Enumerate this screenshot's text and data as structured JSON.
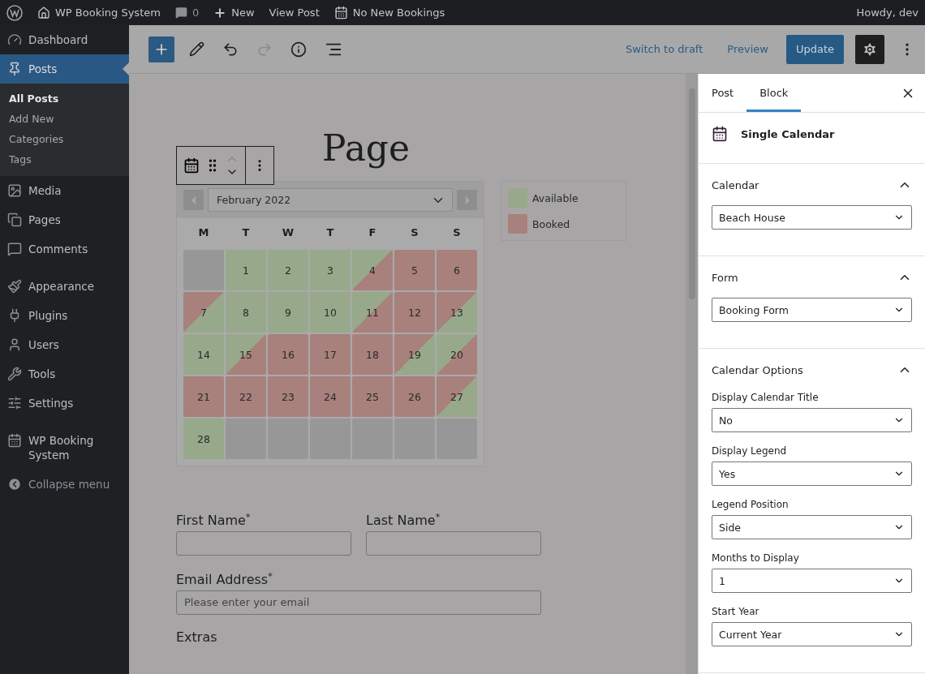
{
  "admin_bar": {
    "site": "WP Booking System",
    "comments": "0",
    "new": "New",
    "view": "View Post",
    "bookings": "No New Bookings",
    "greeting": "Howdy, dev"
  },
  "sidebar": {
    "items": [
      {
        "label": "Dashboard",
        "selected": false
      },
      {
        "label": "Posts",
        "selected": true,
        "children": [
          {
            "label": "All Posts",
            "selected": true
          },
          {
            "label": "Add New",
            "selected": false
          },
          {
            "label": "Categories",
            "selected": false
          },
          {
            "label": "Tags",
            "selected": false
          }
        ]
      },
      {
        "label": "Media",
        "selected": false
      },
      {
        "label": "Pages",
        "selected": false
      },
      {
        "label": "Comments",
        "selected": false
      },
      {
        "label": "Appearance",
        "selected": false
      },
      {
        "label": "Plugins",
        "selected": false
      },
      {
        "label": "Users",
        "selected": false
      },
      {
        "label": "Tools",
        "selected": false
      },
      {
        "label": "Settings",
        "selected": false
      },
      {
        "label": "WP Booking System",
        "selected": false
      }
    ],
    "collapse": "Collapse menu"
  },
  "editor_header": {
    "switch_draft": "Switch to draft",
    "preview": "Preview",
    "update": "Update"
  },
  "post": {
    "title": "Page",
    "calendar": {
      "month": "February 2022",
      "weekdays": [
        "M",
        "T",
        "W",
        "T",
        "F",
        "S",
        "S"
      ],
      "days": [
        {
          "kind": "empty"
        },
        {
          "label": "1",
          "kind": "available"
        },
        {
          "label": "2",
          "kind": "available"
        },
        {
          "label": "3",
          "kind": "available"
        },
        {
          "label": "4",
          "kind": "available-booked"
        },
        {
          "label": "5",
          "kind": "booked"
        },
        {
          "label": "6",
          "kind": "booked"
        },
        {
          "label": "7",
          "kind": "booked-available"
        },
        {
          "label": "8",
          "kind": "available"
        },
        {
          "label": "9",
          "kind": "available"
        },
        {
          "label": "10",
          "kind": "available"
        },
        {
          "label": "11",
          "kind": "available-booked"
        },
        {
          "label": "12",
          "kind": "booked"
        },
        {
          "label": "13",
          "kind": "booked-available"
        },
        {
          "label": "14",
          "kind": "available"
        },
        {
          "label": "15",
          "kind": "available-booked"
        },
        {
          "label": "16",
          "kind": "booked"
        },
        {
          "label": "17",
          "kind": "booked"
        },
        {
          "label": "18",
          "kind": "booked"
        },
        {
          "label": "19",
          "kind": "booked-available"
        },
        {
          "label": "20",
          "kind": "available-booked"
        },
        {
          "label": "21",
          "kind": "booked"
        },
        {
          "label": "22",
          "kind": "booked"
        },
        {
          "label": "23",
          "kind": "booked"
        },
        {
          "label": "24",
          "kind": "booked"
        },
        {
          "label": "25",
          "kind": "booked"
        },
        {
          "label": "26",
          "kind": "booked"
        },
        {
          "label": "27",
          "kind": "booked-available"
        },
        {
          "label": "28",
          "kind": "available"
        },
        {
          "kind": "empty"
        },
        {
          "kind": "empty"
        },
        {
          "kind": "empty"
        },
        {
          "kind": "empty"
        },
        {
          "kind": "empty"
        },
        {
          "kind": "empty"
        }
      ]
    },
    "legend": [
      {
        "label": "Available",
        "color": "#97a98a"
      },
      {
        "label": "Booked",
        "color": "#a8807c"
      }
    ],
    "form": {
      "first_name": "First Name$^{*}$",
      "last_name": "Last Name$^{*}$",
      "email": "Email Address$^{*}$",
      "email_placeholder": "Please enter your email",
      "extras": "Extras"
    }
  },
  "inspector": {
    "tabs": [
      {
        "label": "Post",
        "selected": false
      },
      {
        "label": "Block",
        "selected": true
      }
    ],
    "block_name": "Single Calendar",
    "sections": [
      {
        "title": "Calendar",
        "expanded": true,
        "fields": [
          {
            "value": "Beach House"
          }
        ]
      },
      {
        "title": "Form",
        "expanded": true,
        "fields": [
          {
            "value": "Booking Form"
          }
        ]
      },
      {
        "title": "Calendar Options",
        "expanded": true,
        "fields": [
          {
            "label": "Display Calendar Title",
            "value": "No"
          },
          {
            "label": "Display Legend",
            "value": "Yes"
          },
          {
            "label": "Legend Position",
            "value": "Side"
          },
          {
            "label": "Months to Display",
            "value": "1"
          },
          {
            "label": "Start Year",
            "value": "Current Year"
          }
        ]
      }
    ]
  }
}
